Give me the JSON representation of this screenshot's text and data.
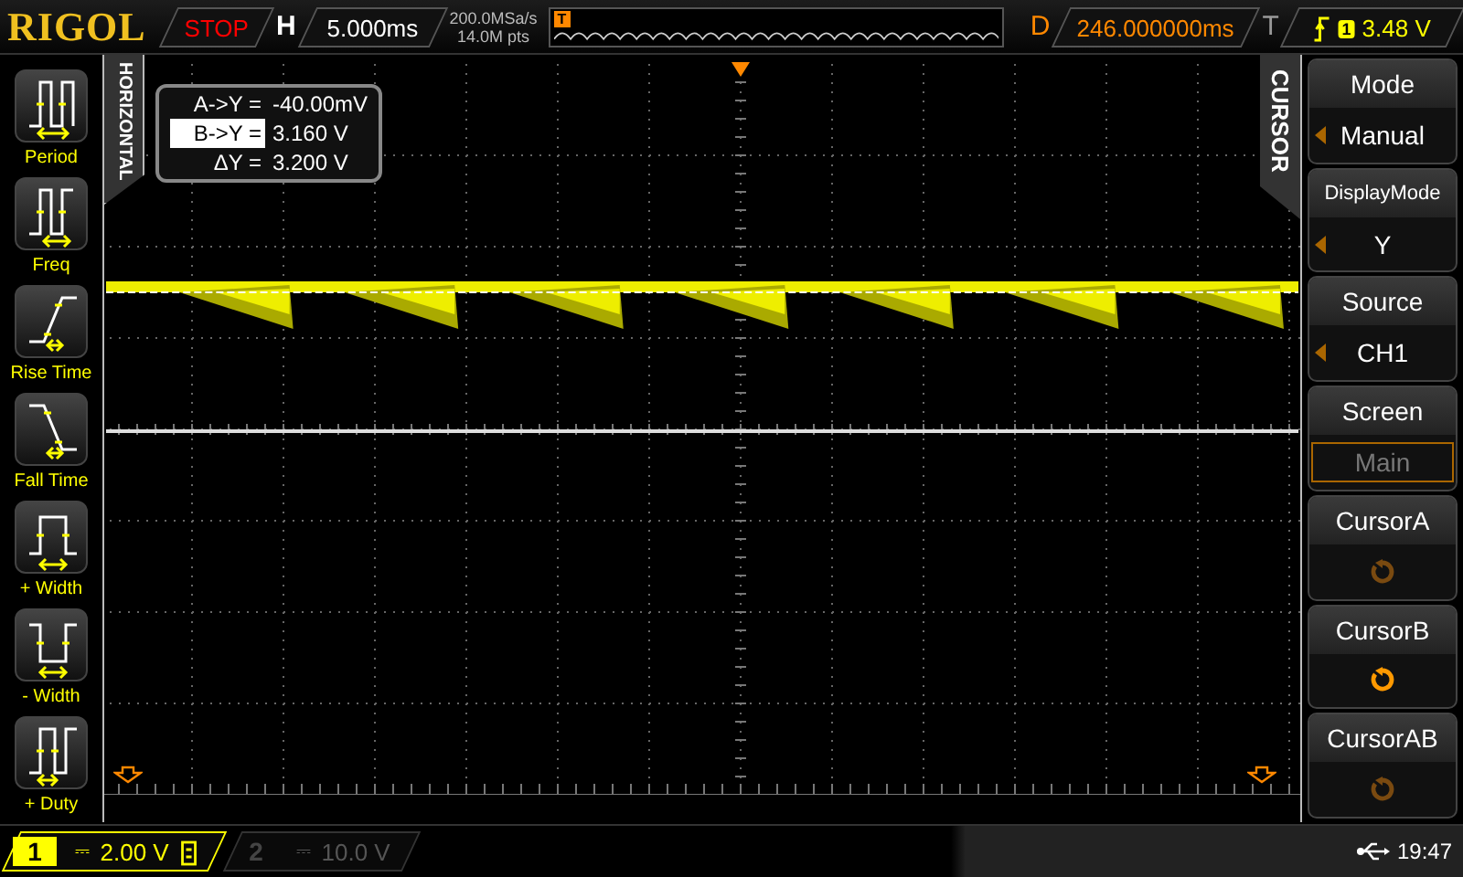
{
  "top_bar": {
    "logo": "RIGOL",
    "run_state": "STOP",
    "timebase_label": "H",
    "timebase": "5.000ms",
    "sample_rate": "200.0MSa/s",
    "memory_depth": "14.0M pts",
    "trigger_marker": "T",
    "delay_label": "D",
    "delay": "246.000000ms",
    "trigger_label": "T",
    "trigger_channel": "1",
    "trigger_level": "3.48 V"
  },
  "horizontal_tab": "HORIZONTAL",
  "measure_items": [
    {
      "kind": "period",
      "label": "Period"
    },
    {
      "kind": "freq",
      "label": "Freq"
    },
    {
      "kind": "rise",
      "label": "Rise Time"
    },
    {
      "kind": "fall",
      "label": "Fall Time"
    },
    {
      "kind": "pwidth",
      "label": "+ Width"
    },
    {
      "kind": "nwidth",
      "label": "- Width"
    },
    {
      "kind": "duty",
      "label": "+ Duty"
    }
  ],
  "cursor_readout": [
    {
      "label": "A->Y =",
      "value": "-40.00mV",
      "selected": false
    },
    {
      "label": "B->Y =",
      "value": "3.160 V",
      "selected": true
    },
    {
      "label": "ΔY =",
      "value": "3.200 V",
      "selected": false
    }
  ],
  "cursor_tab": "CURSOR",
  "cursor_menu": [
    {
      "kind": "choice",
      "title": "Mode",
      "value": "Manual"
    },
    {
      "kind": "choice",
      "title": "DisplayMode",
      "value": "Y"
    },
    {
      "kind": "choice",
      "title": "Source",
      "value": "CH1"
    },
    {
      "kind": "box",
      "title": "Screen",
      "value": "Main",
      "disabled": true
    },
    {
      "kind": "knob",
      "title": "CursorA",
      "selected": false
    },
    {
      "kind": "knob",
      "title": "CursorB",
      "selected": true
    },
    {
      "kind": "knob",
      "title": "CursorAB",
      "selected": false
    }
  ],
  "channels": [
    {
      "number": "1",
      "coupling": "⎓",
      "scale": "2.00 V",
      "on": true
    },
    {
      "number": "2",
      "coupling": "⎓",
      "scale": "10.0 V",
      "on": false
    }
  ],
  "status_bar": {
    "time": "19:47"
  }
}
